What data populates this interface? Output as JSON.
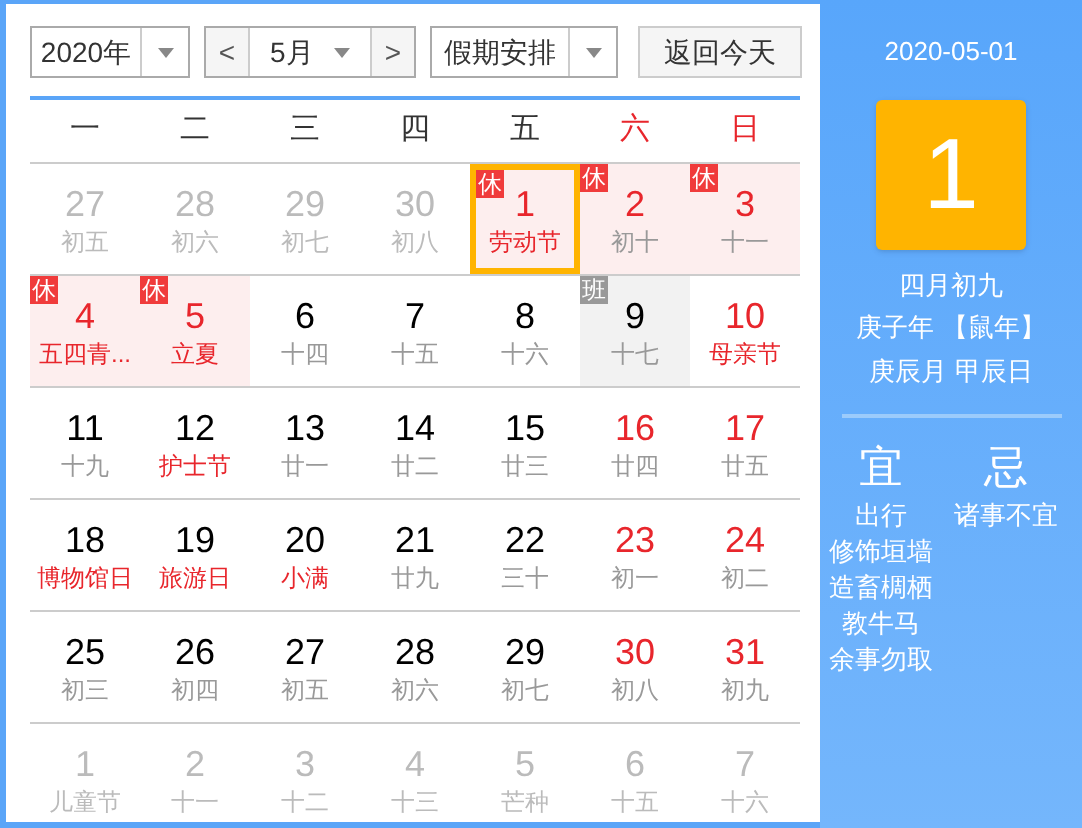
{
  "toolbar": {
    "year": "2020年",
    "prev": "<",
    "month": "5月",
    "next": ">",
    "holiday": "假期安排",
    "today_button": "返回今天"
  },
  "weekdays": [
    {
      "label": "一",
      "weekend": false
    },
    {
      "label": "二",
      "weekend": false
    },
    {
      "label": "三",
      "weekend": false
    },
    {
      "label": "四",
      "weekend": false
    },
    {
      "label": "五",
      "weekend": false
    },
    {
      "label": "六",
      "weekend": true
    },
    {
      "label": "日",
      "weekend": true
    }
  ],
  "weeks": [
    [
      {
        "day": "27",
        "sub": "初五",
        "other_month": true,
        "red": false,
        "festival": false,
        "rest": false,
        "work": false,
        "selected": false
      },
      {
        "day": "28",
        "sub": "初六",
        "other_month": true,
        "red": false,
        "festival": false,
        "rest": false,
        "work": false,
        "selected": false
      },
      {
        "day": "29",
        "sub": "初七",
        "other_month": true,
        "red": false,
        "festival": false,
        "rest": false,
        "work": false,
        "selected": false
      },
      {
        "day": "30",
        "sub": "初八",
        "other_month": true,
        "red": false,
        "festival": false,
        "rest": false,
        "work": false,
        "selected": false
      },
      {
        "day": "1",
        "sub": "劳动节",
        "other_month": false,
        "red": true,
        "festival": true,
        "rest": true,
        "work": false,
        "badge": "休",
        "selected": true
      },
      {
        "day": "2",
        "sub": "初十",
        "other_month": false,
        "red": true,
        "festival": false,
        "rest": true,
        "work": false,
        "badge": "休",
        "selected": false
      },
      {
        "day": "3",
        "sub": "十一",
        "other_month": false,
        "red": true,
        "festival": false,
        "rest": true,
        "work": false,
        "badge": "休",
        "selected": false
      }
    ],
    [
      {
        "day": "4",
        "sub": "五四青...",
        "other_month": false,
        "red": true,
        "festival": true,
        "rest": true,
        "work": false,
        "badge": "休",
        "selected": false
      },
      {
        "day": "5",
        "sub": "立夏",
        "other_month": false,
        "red": true,
        "festival": true,
        "rest": true,
        "work": false,
        "badge": "休",
        "selected": false
      },
      {
        "day": "6",
        "sub": "十四",
        "other_month": false,
        "red": false,
        "festival": false,
        "rest": false,
        "work": false,
        "selected": false
      },
      {
        "day": "7",
        "sub": "十五",
        "other_month": false,
        "red": false,
        "festival": false,
        "rest": false,
        "work": false,
        "selected": false
      },
      {
        "day": "8",
        "sub": "十六",
        "other_month": false,
        "red": false,
        "festival": false,
        "rest": false,
        "work": false,
        "selected": false
      },
      {
        "day": "9",
        "sub": "十七",
        "other_month": false,
        "red": false,
        "festival": false,
        "rest": false,
        "work": true,
        "badge": "班",
        "selected": false
      },
      {
        "day": "10",
        "sub": "母亲节",
        "other_month": false,
        "red": true,
        "festival": true,
        "rest": false,
        "work": false,
        "selected": false
      }
    ],
    [
      {
        "day": "11",
        "sub": "十九",
        "other_month": false,
        "red": false,
        "festival": false,
        "rest": false,
        "work": false,
        "selected": false
      },
      {
        "day": "12",
        "sub": "护士节",
        "other_month": false,
        "red": false,
        "festival": true,
        "rest": false,
        "work": false,
        "selected": false
      },
      {
        "day": "13",
        "sub": "廿一",
        "other_month": false,
        "red": false,
        "festival": false,
        "rest": false,
        "work": false,
        "selected": false
      },
      {
        "day": "14",
        "sub": "廿二",
        "other_month": false,
        "red": false,
        "festival": false,
        "rest": false,
        "work": false,
        "selected": false
      },
      {
        "day": "15",
        "sub": "廿三",
        "other_month": false,
        "red": false,
        "festival": false,
        "rest": false,
        "work": false,
        "selected": false
      },
      {
        "day": "16",
        "sub": "廿四",
        "other_month": false,
        "red": true,
        "festival": false,
        "rest": false,
        "work": false,
        "selected": false
      },
      {
        "day": "17",
        "sub": "廿五",
        "other_month": false,
        "red": true,
        "festival": false,
        "rest": false,
        "work": false,
        "selected": false
      }
    ],
    [
      {
        "day": "18",
        "sub": "博物馆日",
        "other_month": false,
        "red": false,
        "festival": true,
        "rest": false,
        "work": false,
        "selected": false
      },
      {
        "day": "19",
        "sub": "旅游日",
        "other_month": false,
        "red": false,
        "festival": true,
        "rest": false,
        "work": false,
        "selected": false
      },
      {
        "day": "20",
        "sub": "小满",
        "other_month": false,
        "red": false,
        "festival": true,
        "rest": false,
        "work": false,
        "selected": false
      },
      {
        "day": "21",
        "sub": "廿九",
        "other_month": false,
        "red": false,
        "festival": false,
        "rest": false,
        "work": false,
        "selected": false
      },
      {
        "day": "22",
        "sub": "三十",
        "other_month": false,
        "red": false,
        "festival": false,
        "rest": false,
        "work": false,
        "selected": false
      },
      {
        "day": "23",
        "sub": "初一",
        "other_month": false,
        "red": true,
        "festival": false,
        "rest": false,
        "work": false,
        "selected": false
      },
      {
        "day": "24",
        "sub": "初二",
        "other_month": false,
        "red": true,
        "festival": false,
        "rest": false,
        "work": false,
        "selected": false
      }
    ],
    [
      {
        "day": "25",
        "sub": "初三",
        "other_month": false,
        "red": false,
        "festival": false,
        "rest": false,
        "work": false,
        "selected": false
      },
      {
        "day": "26",
        "sub": "初四",
        "other_month": false,
        "red": false,
        "festival": false,
        "rest": false,
        "work": false,
        "selected": false
      },
      {
        "day": "27",
        "sub": "初五",
        "other_month": false,
        "red": false,
        "festival": false,
        "rest": false,
        "work": false,
        "selected": false
      },
      {
        "day": "28",
        "sub": "初六",
        "other_month": false,
        "red": false,
        "festival": false,
        "rest": false,
        "work": false,
        "selected": false
      },
      {
        "day": "29",
        "sub": "初七",
        "other_month": false,
        "red": false,
        "festival": false,
        "rest": false,
        "work": false,
        "selected": false
      },
      {
        "day": "30",
        "sub": "初八",
        "other_month": false,
        "red": true,
        "festival": false,
        "rest": false,
        "work": false,
        "selected": false
      },
      {
        "day": "31",
        "sub": "初九",
        "other_month": false,
        "red": true,
        "festival": false,
        "rest": false,
        "work": false,
        "selected": false
      }
    ],
    [
      {
        "day": "1",
        "sub": "儿童节",
        "other_month": true,
        "red": false,
        "festival": false,
        "rest": false,
        "work": false,
        "selected": false
      },
      {
        "day": "2",
        "sub": "十一",
        "other_month": true,
        "red": false,
        "festival": false,
        "rest": false,
        "work": false,
        "selected": false
      },
      {
        "day": "3",
        "sub": "十二",
        "other_month": true,
        "red": false,
        "festival": false,
        "rest": false,
        "work": false,
        "selected": false
      },
      {
        "day": "4",
        "sub": "十三",
        "other_month": true,
        "red": false,
        "festival": false,
        "rest": false,
        "work": false,
        "selected": false
      },
      {
        "day": "5",
        "sub": "芒种",
        "other_month": true,
        "red": false,
        "festival": false,
        "rest": false,
        "work": false,
        "selected": false
      },
      {
        "day": "6",
        "sub": "十五",
        "other_month": true,
        "red": false,
        "festival": false,
        "rest": false,
        "work": false,
        "selected": false
      },
      {
        "day": "7",
        "sub": "十六",
        "other_month": true,
        "red": false,
        "festival": false,
        "rest": false,
        "work": false,
        "selected": false
      }
    ]
  ],
  "detail": {
    "date": "2020-05-01",
    "big_day": "1",
    "lunar": "四月初九",
    "year_line": "庚子年 【鼠年】",
    "month_day": "庚辰月 甲辰日",
    "yi_title": "宜",
    "ji_title": "忌",
    "yi": [
      "出行",
      "修饰垣墙",
      "造畜椆栖",
      "教牛马",
      "余事勿取"
    ],
    "ji": [
      "诸事不宜"
    ]
  }
}
